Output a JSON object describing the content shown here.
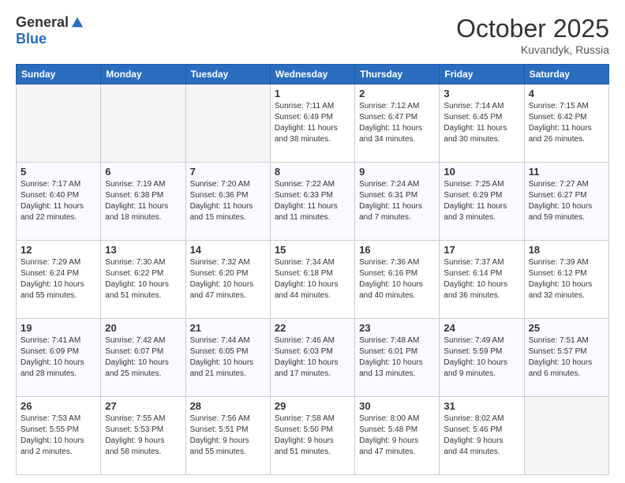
{
  "header": {
    "logo_general": "General",
    "logo_blue": "Blue",
    "month": "October 2025",
    "location": "Kuvandyk, Russia"
  },
  "days_of_week": [
    "Sunday",
    "Monday",
    "Tuesday",
    "Wednesday",
    "Thursday",
    "Friday",
    "Saturday"
  ],
  "weeks": [
    [
      {
        "day": "",
        "info": ""
      },
      {
        "day": "",
        "info": ""
      },
      {
        "day": "",
        "info": ""
      },
      {
        "day": "1",
        "info": "Sunrise: 7:11 AM\nSunset: 6:49 PM\nDaylight: 11 hours\nand 38 minutes."
      },
      {
        "day": "2",
        "info": "Sunrise: 7:12 AM\nSunset: 6:47 PM\nDaylight: 11 hours\nand 34 minutes."
      },
      {
        "day": "3",
        "info": "Sunrise: 7:14 AM\nSunset: 6:45 PM\nDaylight: 11 hours\nand 30 minutes."
      },
      {
        "day": "4",
        "info": "Sunrise: 7:15 AM\nSunset: 6:42 PM\nDaylight: 11 hours\nand 26 minutes."
      }
    ],
    [
      {
        "day": "5",
        "info": "Sunrise: 7:17 AM\nSunset: 6:40 PM\nDaylight: 11 hours\nand 22 minutes."
      },
      {
        "day": "6",
        "info": "Sunrise: 7:19 AM\nSunset: 6:38 PM\nDaylight: 11 hours\nand 18 minutes."
      },
      {
        "day": "7",
        "info": "Sunrise: 7:20 AM\nSunset: 6:36 PM\nDaylight: 11 hours\nand 15 minutes."
      },
      {
        "day": "8",
        "info": "Sunrise: 7:22 AM\nSunset: 6:33 PM\nDaylight: 11 hours\nand 11 minutes."
      },
      {
        "day": "9",
        "info": "Sunrise: 7:24 AM\nSunset: 6:31 PM\nDaylight: 11 hours\nand 7 minutes."
      },
      {
        "day": "10",
        "info": "Sunrise: 7:25 AM\nSunset: 6:29 PM\nDaylight: 11 hours\nand 3 minutes."
      },
      {
        "day": "11",
        "info": "Sunrise: 7:27 AM\nSunset: 6:27 PM\nDaylight: 10 hours\nand 59 minutes."
      }
    ],
    [
      {
        "day": "12",
        "info": "Sunrise: 7:29 AM\nSunset: 6:24 PM\nDaylight: 10 hours\nand 55 minutes."
      },
      {
        "day": "13",
        "info": "Sunrise: 7:30 AM\nSunset: 6:22 PM\nDaylight: 10 hours\nand 51 minutes."
      },
      {
        "day": "14",
        "info": "Sunrise: 7:32 AM\nSunset: 6:20 PM\nDaylight: 10 hours\nand 47 minutes."
      },
      {
        "day": "15",
        "info": "Sunrise: 7:34 AM\nSunset: 6:18 PM\nDaylight: 10 hours\nand 44 minutes."
      },
      {
        "day": "16",
        "info": "Sunrise: 7:36 AM\nSunset: 6:16 PM\nDaylight: 10 hours\nand 40 minutes."
      },
      {
        "day": "17",
        "info": "Sunrise: 7:37 AM\nSunset: 6:14 PM\nDaylight: 10 hours\nand 36 minutes."
      },
      {
        "day": "18",
        "info": "Sunrise: 7:39 AM\nSunset: 6:12 PM\nDaylight: 10 hours\nand 32 minutes."
      }
    ],
    [
      {
        "day": "19",
        "info": "Sunrise: 7:41 AM\nSunset: 6:09 PM\nDaylight: 10 hours\nand 28 minutes."
      },
      {
        "day": "20",
        "info": "Sunrise: 7:42 AM\nSunset: 6:07 PM\nDaylight: 10 hours\nand 25 minutes."
      },
      {
        "day": "21",
        "info": "Sunrise: 7:44 AM\nSunset: 6:05 PM\nDaylight: 10 hours\nand 21 minutes."
      },
      {
        "day": "22",
        "info": "Sunrise: 7:46 AM\nSunset: 6:03 PM\nDaylight: 10 hours\nand 17 minutes."
      },
      {
        "day": "23",
        "info": "Sunrise: 7:48 AM\nSunset: 6:01 PM\nDaylight: 10 hours\nand 13 minutes."
      },
      {
        "day": "24",
        "info": "Sunrise: 7:49 AM\nSunset: 5:59 PM\nDaylight: 10 hours\nand 9 minutes."
      },
      {
        "day": "25",
        "info": "Sunrise: 7:51 AM\nSunset: 5:57 PM\nDaylight: 10 hours\nand 6 minutes."
      }
    ],
    [
      {
        "day": "26",
        "info": "Sunrise: 7:53 AM\nSunset: 5:55 PM\nDaylight: 10 hours\nand 2 minutes."
      },
      {
        "day": "27",
        "info": "Sunrise: 7:55 AM\nSunset: 5:53 PM\nDaylight: 9 hours\nand 58 minutes."
      },
      {
        "day": "28",
        "info": "Sunrise: 7:56 AM\nSunset: 5:51 PM\nDaylight: 9 hours\nand 55 minutes."
      },
      {
        "day": "29",
        "info": "Sunrise: 7:58 AM\nSunset: 5:50 PM\nDaylight: 9 hours\nand 51 minutes."
      },
      {
        "day": "30",
        "info": "Sunrise: 8:00 AM\nSunset: 5:48 PM\nDaylight: 9 hours\nand 47 minutes."
      },
      {
        "day": "31",
        "info": "Sunrise: 8:02 AM\nSunset: 5:46 PM\nDaylight: 9 hours\nand 44 minutes."
      },
      {
        "day": "",
        "info": ""
      }
    ]
  ]
}
